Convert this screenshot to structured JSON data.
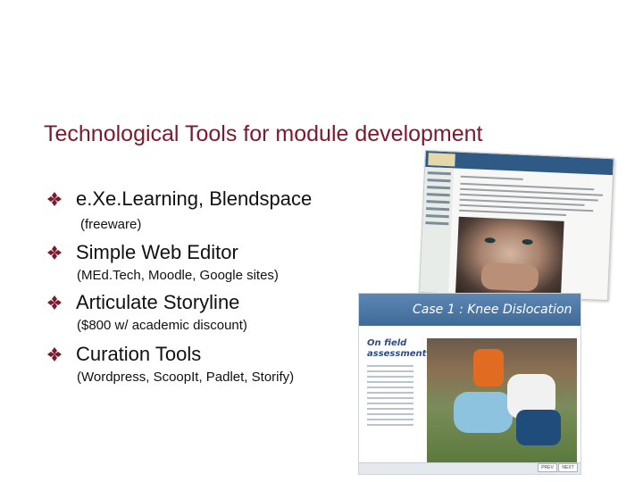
{
  "slide": {
    "title": "Technological Tools for module development",
    "accent_color": "#7b1a2e",
    "bullet_icon": "diamond-bullet-icon",
    "bullets": [
      {
        "label": "e.Xe.Learning, Blendspace",
        "detail": "(freeware)"
      },
      {
        "label": "Simple Web Editor",
        "detail": "(MEd.Tech, Moodle, Google sites)"
      },
      {
        "label": "Articulate Storyline",
        "detail": "($800 w/ academic discount)"
      },
      {
        "label": "Curation Tools",
        "detail": "(Wordpress, ScoopIt, Padlet, Storify)"
      }
    ]
  },
  "screenshots": {
    "storyline": {
      "title": "Case 1 : Knee Dislocation",
      "heading": "On field assessment:",
      "prev_label": "PREV",
      "next_label": "NEXT"
    }
  }
}
